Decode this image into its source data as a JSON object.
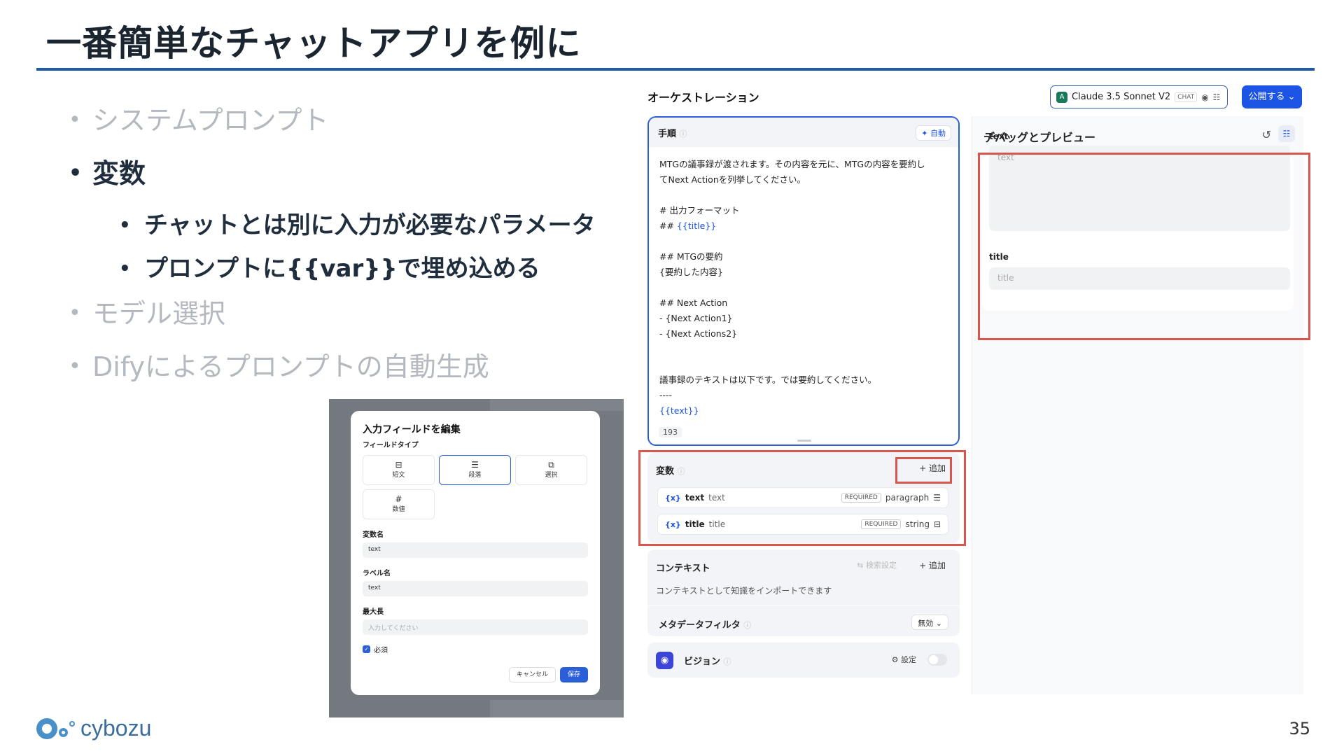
{
  "slide": {
    "title": "一番簡単なチャットアプリを例に",
    "page_number": "35",
    "logo_text": "cybozu"
  },
  "bullets": [
    {
      "text": "システムプロンプト",
      "active": false
    },
    {
      "text": "変数",
      "active": true
    },
    {
      "text": "モデル選択",
      "active": false
    },
    {
      "text": "Difyによるプロンプトの自動生成",
      "active": false
    }
  ],
  "sub_bullets": [
    "チャットとは別に入力が必要なパラメータ",
    "プロンプトに{{var}}で埋め込める"
  ],
  "modal": {
    "title": "入力フィールドを編集",
    "field_type_label": "フィールドタイプ",
    "types": [
      {
        "icon": "text-input-icon",
        "label": "短文"
      },
      {
        "icon": "paragraph-icon",
        "label": "段落"
      },
      {
        "icon": "select-icon",
        "label": "選択"
      },
      {
        "icon": "number-icon",
        "label": "数値"
      }
    ],
    "var_name_label": "変数名",
    "var_name_value": "text",
    "label_name_label": "ラベル名",
    "label_name_value": "text",
    "max_length_label": "最大長",
    "max_length_placeholder": "入力してください",
    "required_label": "必須",
    "cancel": "キャンセル",
    "save": "保存"
  },
  "orchestration": {
    "title": "オーケストレーション",
    "model_name": "Claude 3.5 Sonnet V2",
    "model_tag": "CHAT",
    "publish": "公開する ⌄",
    "steps_title": "手順",
    "auto_label": "自動",
    "prompt_lines": [
      "MTGの議事録が渡されます。その内容を元に、MTGの内容を要約し",
      "てNext Actionを列挙してください。",
      "",
      "# 出力フォーマット",
      "## {{title}}",
      "",
      "## MTGの要約",
      "{要約した内容}",
      "",
      "## Next Action",
      "- {Next Action1}",
      "- {Next Actions2}",
      "",
      "",
      "議事録のテキストは以下です。では要約してください。",
      "----",
      "{{text}}"
    ],
    "char_count": "193",
    "variables_title": "変数",
    "add_label": "+ 追加",
    "variables": [
      {
        "name": "text",
        "label": "text",
        "required": "REQUIRED",
        "type": "paragraph"
      },
      {
        "name": "title",
        "label": "title",
        "required": "REQUIRED",
        "type": "string"
      }
    ],
    "context_title": "コンテキスト",
    "search_settings": "検索設定",
    "context_add": "+ 追加",
    "context_desc": "コンテキストとして知識をインポートできます",
    "metadata_filter": "メタデータフィルタ",
    "metadata_value": "無効 ⌄",
    "vision_title": "ビジョン",
    "vision_settings": "設定"
  },
  "debug": {
    "title": "デバッグとプレビュー",
    "field1_label": "text",
    "field1_placeholder": "text",
    "field2_label": "title",
    "field2_placeholder": "title"
  },
  "colors": {
    "accent": "#1c55e5",
    "highlight": "#d9564f",
    "title_rule": "#1e5aa8"
  }
}
